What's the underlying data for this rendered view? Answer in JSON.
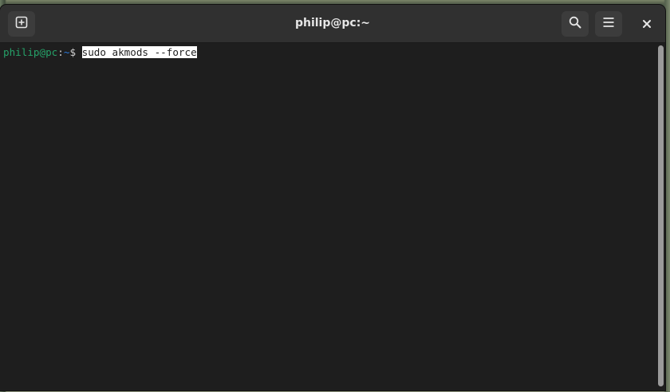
{
  "window": {
    "title": "philip@pc:~"
  },
  "headerbar": {
    "new_tab_icon": "new-tab-icon",
    "search_icon": "search-icon",
    "menu_icon": "hamburger-menu-icon",
    "close_icon": "close-icon"
  },
  "terminal": {
    "prompt_user": "philip@pc",
    "prompt_sep": ":",
    "prompt_path": "~",
    "prompt_symbol": "$ ",
    "command": "sudo akmods --force"
  },
  "colors": {
    "background": "#1e1e1e",
    "headerbar": "#303030",
    "prompt_user": "#26a269",
    "prompt_path": "#2a7bde",
    "selection": "#ffffff"
  }
}
